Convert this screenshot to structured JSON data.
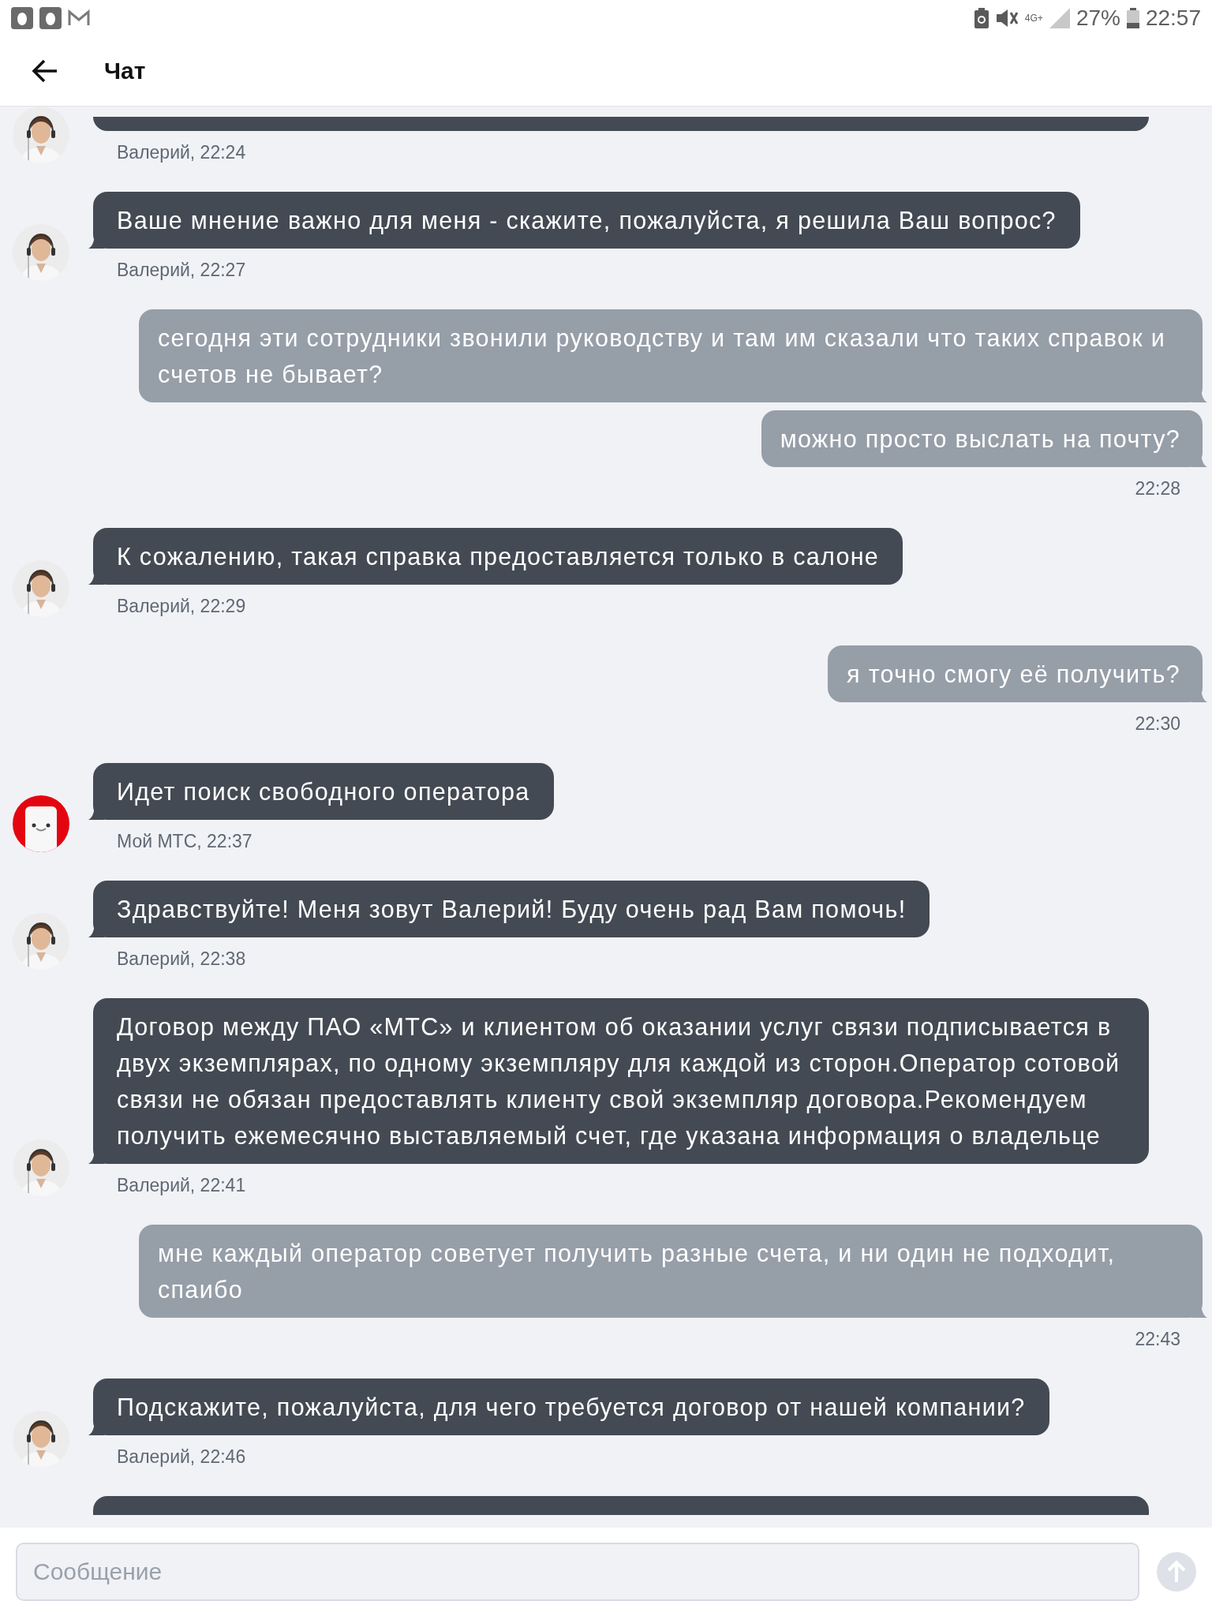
{
  "status_bar": {
    "network": "4G+",
    "battery": "27%",
    "time": "22:57"
  },
  "header": {
    "title": "Чат"
  },
  "messages": [
    {
      "kind": "agent_partial_bottom",
      "meta": "Валерий, 22:24"
    },
    {
      "kind": "agent_message",
      "text": "Ваше мнение важно для меня - скажите, пожалуйста, я решила Ваш вопрос?",
      "meta": "Валерий, 22:27"
    },
    {
      "kind": "user_message",
      "text": "сегодня эти сотрудники звонили руководству и там им сказали что таких справок и счетов не бывает?"
    },
    {
      "kind": "user_message",
      "text": "можно просто выслать на почту?",
      "meta": "22:28"
    },
    {
      "kind": "agent_message",
      "text": "К сожалению, такая справка предоставляется только в салоне",
      "meta": "Валерий, 22:29"
    },
    {
      "kind": "user_message",
      "text": "я точно смогу её получить?",
      "meta": "22:30"
    },
    {
      "kind": "bot_message",
      "text": "Идет поиск свободного оператора",
      "meta": "Мой МТС, 22:37"
    },
    {
      "kind": "agent_message",
      "text": "Здравствуйте! Меня зовут Валерий! Буду очень рад Вам помочь!",
      "meta": "Валерий, 22:38"
    },
    {
      "kind": "agent_message",
      "text": "Договор между ПАО «МТС» и клиентом об оказании услуг связи подписывается в двух экземплярах, по одному экземпляру для каждой из сторон.Оператор сотовой связи не обязан предоставлять клиенту свой экземпляр договора.Рекомендуем получить ежемесячно выставляемый счет, где указана информация о владельце",
      "meta": "Валерий, 22:41"
    },
    {
      "kind": "user_message",
      "text": "мне каждый оператор советует получить разные счета, и ни один не подходит, спаибо",
      "meta": "22:43"
    },
    {
      "kind": "agent_message",
      "text": "Подскажите, пожалуйста, для чего требуется договор от нашей компании?",
      "meta": "Валерий, 22:46"
    },
    {
      "kind": "agent_partial_top"
    }
  ],
  "input": {
    "placeholder": "Сообщение"
  }
}
